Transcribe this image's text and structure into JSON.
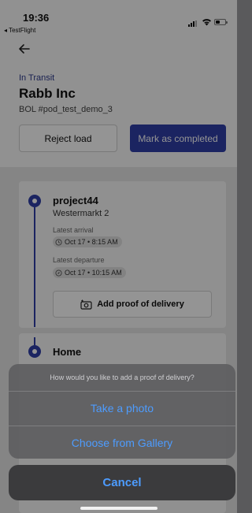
{
  "status_bar": {
    "time": "19:36",
    "back_app": "◂ TestFlight"
  },
  "header": {
    "status": "In Transit",
    "company": "Rabb Inc",
    "bol": "BOL #pod_test_demo_3",
    "reject_label": "Reject load",
    "complete_label": "Mark as completed"
  },
  "stops": [
    {
      "name": "project44",
      "address": "Westermarkt 2",
      "arrival_label": "Latest arrival",
      "arrival_value": "Oct 17 • 8:15 AM",
      "departure_label": "Latest departure",
      "departure_value": "Oct 17 • 10:15 AM",
      "pod_label": "Add proof of delivery"
    },
    {
      "name": "Home"
    }
  ],
  "action_sheet": {
    "title": "How would you like to add a proof of delivery?",
    "options": [
      "Take a photo",
      "Choose from Gallery"
    ],
    "cancel_label": "Cancel"
  },
  "colors": {
    "accent": "#2f3ea8",
    "action_text": "#4d9cff",
    "sheet_bg": "#606062"
  }
}
